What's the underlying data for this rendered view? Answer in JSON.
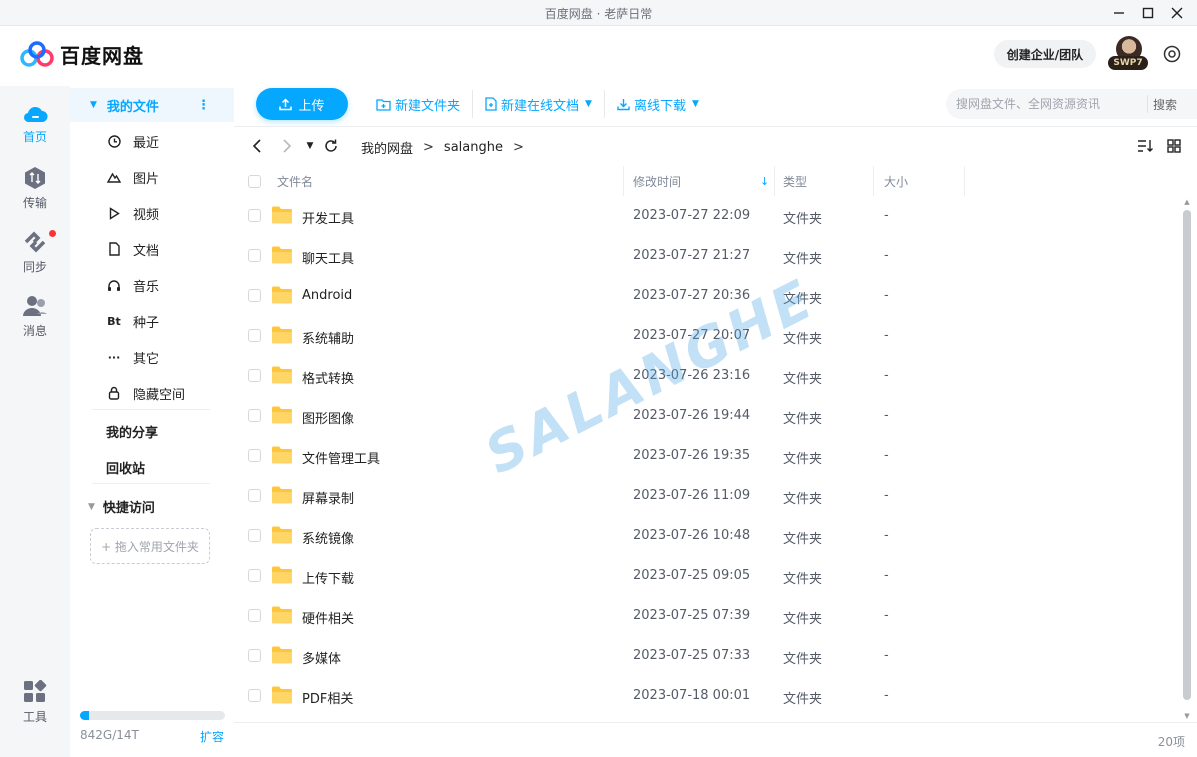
{
  "window": {
    "title": "百度网盘 · 老萨日常"
  },
  "app": {
    "name": "百度网盘"
  },
  "header": {
    "team_button": "创建企业/团队",
    "user_tag": "SWP7"
  },
  "left_nav": [
    {
      "label": "首页",
      "icon": "cloud-icon"
    },
    {
      "label": "传输",
      "icon": "transfer-icon"
    },
    {
      "label": "同步",
      "icon": "sync-icon"
    },
    {
      "label": "消息",
      "icon": "message-icon"
    },
    {
      "label": "工具",
      "icon": "tools-icon"
    }
  ],
  "sidebar": {
    "my_files": "我的文件",
    "items": [
      {
        "label": "最近",
        "icon": "clock-icon"
      },
      {
        "label": "图片",
        "icon": "mountain-icon"
      },
      {
        "label": "视频",
        "icon": "play-icon"
      },
      {
        "label": "文档",
        "icon": "document-icon"
      },
      {
        "label": "音乐",
        "icon": "headphones-icon"
      },
      {
        "label": "种子",
        "icon": "bt-icon",
        "glyph": "Bt"
      },
      {
        "label": "其它",
        "icon": "dots-icon",
        "glyph": "···"
      },
      {
        "label": "隐藏空间",
        "icon": "lock-icon"
      }
    ],
    "my_share": "我的分享",
    "recycle": "回收站",
    "quick_access": "快捷访问",
    "drop_hint": "+ 拖入常用文件夹",
    "storage_used": 0.06,
    "storage_text": "842G/14T",
    "expand": "扩容"
  },
  "toolbar": {
    "upload": "上传",
    "new_folder": "新建文件夹",
    "new_online_doc": "新建在线文档",
    "offline_download": "离线下载",
    "search_placeholder": "搜网盘文件、全网资源资讯",
    "search_button": "搜索"
  },
  "breadcrumb": {
    "root": "我的网盘",
    "current": "salanghe"
  },
  "table": {
    "headers": {
      "name": "文件名",
      "modified": "修改时间",
      "type": "类型",
      "size": "大小"
    },
    "rows": [
      {
        "name": "开发工具",
        "modified": "2023-07-27 22:09",
        "type": "文件夹",
        "size": "-"
      },
      {
        "name": "聊天工具",
        "modified": "2023-07-27 21:27",
        "type": "文件夹",
        "size": "-"
      },
      {
        "name": "Android",
        "modified": "2023-07-27 20:36",
        "type": "文件夹",
        "size": "-"
      },
      {
        "name": "系统辅助",
        "modified": "2023-07-27 20:07",
        "type": "文件夹",
        "size": "-"
      },
      {
        "name": "格式转换",
        "modified": "2023-07-26 23:16",
        "type": "文件夹",
        "size": "-"
      },
      {
        "name": "图形图像",
        "modified": "2023-07-26 19:44",
        "type": "文件夹",
        "size": "-"
      },
      {
        "name": "文件管理工具",
        "modified": "2023-07-26 19:35",
        "type": "文件夹",
        "size": "-"
      },
      {
        "name": "屏幕录制",
        "modified": "2023-07-26 11:09",
        "type": "文件夹",
        "size": "-"
      },
      {
        "name": "系统镜像",
        "modified": "2023-07-26 10:48",
        "type": "文件夹",
        "size": "-"
      },
      {
        "name": "上传下载",
        "modified": "2023-07-25 09:05",
        "type": "文件夹",
        "size": "-"
      },
      {
        "name": "硬件相关",
        "modified": "2023-07-25 07:39",
        "type": "文件夹",
        "size": "-"
      },
      {
        "name": "多媒体",
        "modified": "2023-07-25 07:33",
        "type": "文件夹",
        "size": "-"
      },
      {
        "name": "PDF相关",
        "modified": "2023-07-18 00:01",
        "type": "文件夹",
        "size": "-"
      }
    ]
  },
  "footer": {
    "count": "20项"
  },
  "watermark": "SALANGHE",
  "colors": {
    "accent": "#06a7ff",
    "folder": "#ffc53d",
    "badge": "#ff3333"
  }
}
